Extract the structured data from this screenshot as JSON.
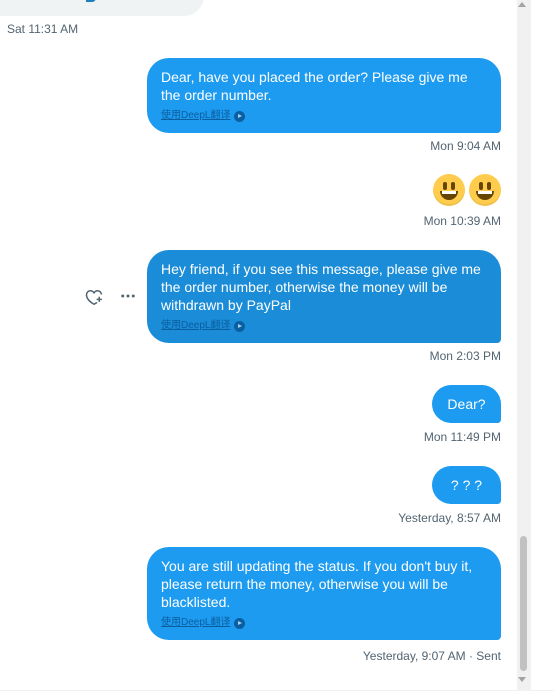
{
  "messages": [
    {
      "id": "m0",
      "direction": "incoming",
      "timestamp": "Sat 11:31 AM"
    },
    {
      "id": "m1",
      "direction": "outgoing",
      "text": "Dear, have you placed the order? Please give me the order number.",
      "translate_label": "使用DeepL翻译",
      "timestamp": "Mon 9:04 AM"
    },
    {
      "id": "m2",
      "direction": "outgoing",
      "emoji": [
        "grinning-face",
        "grinning-face"
      ],
      "timestamp": "Mon 10:39 AM"
    },
    {
      "id": "m3",
      "direction": "outgoing",
      "text": "Hey friend, if you see this message, please give me the order number, otherwise the money will be withdrawn by PayPal",
      "translate_label": "使用DeepL翻译",
      "timestamp": "Mon 2:03 PM",
      "hovered": true
    },
    {
      "id": "m4",
      "direction": "outgoing",
      "text": "Dear?",
      "timestamp": "Mon 11:49 PM"
    },
    {
      "id": "m5",
      "direction": "outgoing",
      "text": "? ? ?",
      "timestamp": "Yesterday, 8:57 AM"
    },
    {
      "id": "m6",
      "direction": "outgoing",
      "text": "You are still updating the status. If you don't buy it, please return the money, otherwise you will be blacklisted.",
      "translate_label": "使用DeepL翻译",
      "timestamp": "Yesterday, 9:07 AM · Sent"
    }
  ],
  "hover_actions": {
    "react_icon": "heart-plus-icon",
    "more_icon": "more-dots-icon"
  },
  "colors": {
    "outgoing_bubble": "#1d9bf0",
    "incoming_bubble": "#eff3f4",
    "timestamp": "#536471"
  }
}
